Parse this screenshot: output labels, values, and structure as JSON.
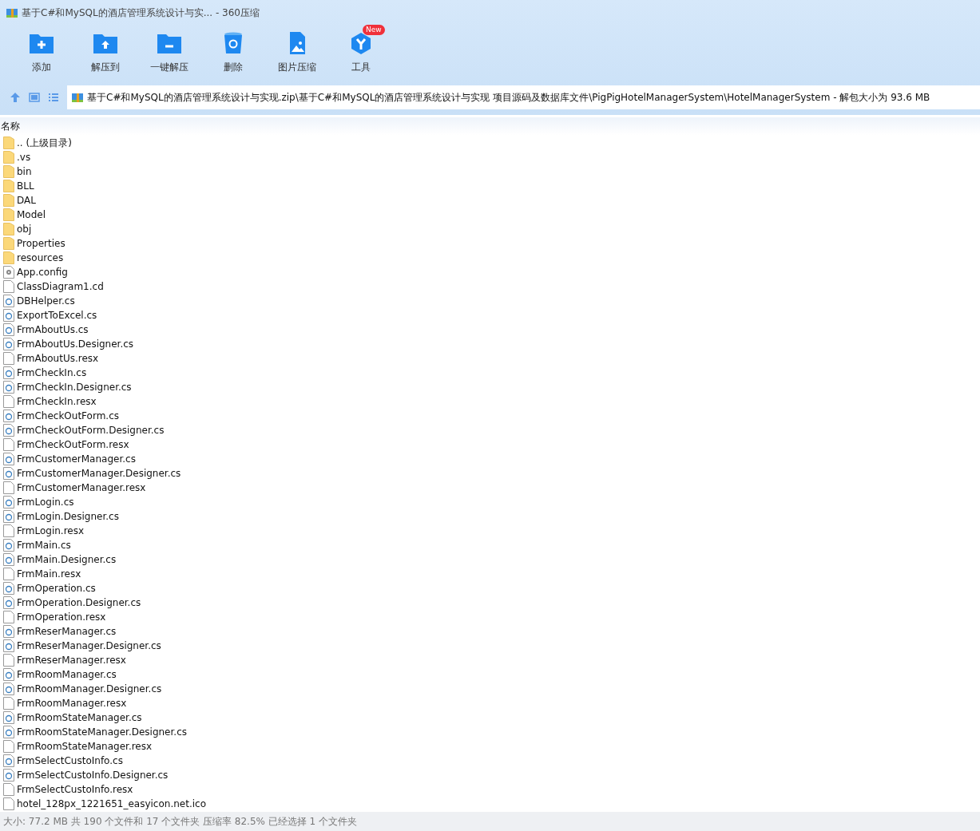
{
  "window": {
    "title": "基于C#和MySQL的酒店管理系统设计与实... - 360压缩"
  },
  "toolbar": [
    {
      "label": "添加",
      "kind": "add"
    },
    {
      "label": "解压到",
      "kind": "extract"
    },
    {
      "label": "一键解压",
      "kind": "oneclick"
    },
    {
      "label": "删除",
      "kind": "delete"
    },
    {
      "label": "图片压缩",
      "kind": "image"
    },
    {
      "label": "工具",
      "kind": "tools",
      "badge": "New"
    }
  ],
  "path_bar": {
    "path": "基于C#和MySQL的酒店管理系统设计与实现.zip\\基于C#和MySQL的酒店管理系统设计与实现 项目源码及数据库文件\\PigPigHotelManagerSystem\\HotelManagerSystem - 解包大小为 93.6 MB"
  },
  "file_list": {
    "columns": [
      "名称"
    ],
    "rows": [
      {
        "name": ".. (上级目录)",
        "kind": "folder"
      },
      {
        "name": ".vs",
        "kind": "folder"
      },
      {
        "name": "bin",
        "kind": "folder"
      },
      {
        "name": "BLL",
        "kind": "folder"
      },
      {
        "name": "DAL",
        "kind": "folder"
      },
      {
        "name": "Model",
        "kind": "folder"
      },
      {
        "name": "obj",
        "kind": "folder"
      },
      {
        "name": "Properties",
        "kind": "folder"
      },
      {
        "name": "resources",
        "kind": "folder"
      },
      {
        "name": "App.config",
        "kind": "config"
      },
      {
        "name": "ClassDiagram1.cd",
        "kind": "file"
      },
      {
        "name": "DBHelper.cs",
        "kind": "cs"
      },
      {
        "name": "ExportToExcel.cs",
        "kind": "cs"
      },
      {
        "name": "FrmAboutUs.cs",
        "kind": "cs"
      },
      {
        "name": "FrmAboutUs.Designer.cs",
        "kind": "cs"
      },
      {
        "name": "FrmAboutUs.resx",
        "kind": "file"
      },
      {
        "name": "FrmCheckIn.cs",
        "kind": "cs"
      },
      {
        "name": "FrmCheckIn.Designer.cs",
        "kind": "cs"
      },
      {
        "name": "FrmCheckIn.resx",
        "kind": "file"
      },
      {
        "name": "FrmCheckOutForm.cs",
        "kind": "cs"
      },
      {
        "name": "FrmCheckOutForm.Designer.cs",
        "kind": "cs"
      },
      {
        "name": "FrmCheckOutForm.resx",
        "kind": "file"
      },
      {
        "name": "FrmCustomerManager.cs",
        "kind": "cs"
      },
      {
        "name": "FrmCustomerManager.Designer.cs",
        "kind": "cs"
      },
      {
        "name": "FrmCustomerManager.resx",
        "kind": "file"
      },
      {
        "name": "FrmLogin.cs",
        "kind": "cs"
      },
      {
        "name": "FrmLogin.Designer.cs",
        "kind": "cs"
      },
      {
        "name": "FrmLogin.resx",
        "kind": "file"
      },
      {
        "name": "FrmMain.cs",
        "kind": "cs"
      },
      {
        "name": "FrmMain.Designer.cs",
        "kind": "cs"
      },
      {
        "name": "FrmMain.resx",
        "kind": "file"
      },
      {
        "name": "FrmOperation.cs",
        "kind": "cs"
      },
      {
        "name": "FrmOperation.Designer.cs",
        "kind": "cs"
      },
      {
        "name": "FrmOperation.resx",
        "kind": "file"
      },
      {
        "name": "FrmReserManager.cs",
        "kind": "cs"
      },
      {
        "name": "FrmReserManager.Designer.cs",
        "kind": "cs"
      },
      {
        "name": "FrmReserManager.resx",
        "kind": "file"
      },
      {
        "name": "FrmRoomManager.cs",
        "kind": "cs"
      },
      {
        "name": "FrmRoomManager.Designer.cs",
        "kind": "cs"
      },
      {
        "name": "FrmRoomManager.resx",
        "kind": "file"
      },
      {
        "name": "FrmRoomStateManager.cs",
        "kind": "cs"
      },
      {
        "name": "FrmRoomStateManager.Designer.cs",
        "kind": "cs"
      },
      {
        "name": "FrmRoomStateManager.resx",
        "kind": "file"
      },
      {
        "name": "FrmSelectCustoInfo.cs",
        "kind": "cs"
      },
      {
        "name": "FrmSelectCustoInfo.Designer.cs",
        "kind": "cs"
      },
      {
        "name": "FrmSelectCustoInfo.resx",
        "kind": "file"
      },
      {
        "name": "hotel_128px_1221651_easyicon.net.ico",
        "kind": "file"
      }
    ]
  },
  "status_bar": "大小: 77.2 MB 共 190 个文件和 17 个文件夹 压缩率 82.5% 已经选择 1 个文件夹"
}
